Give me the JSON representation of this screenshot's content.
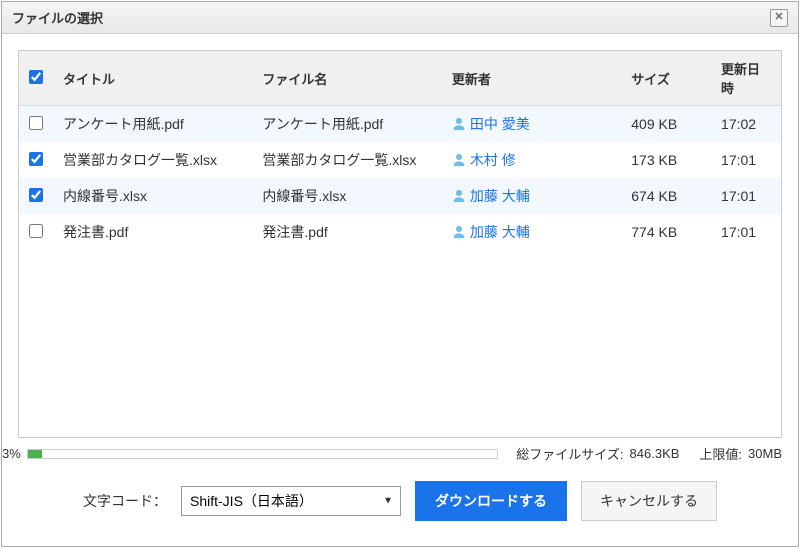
{
  "titlebar": {
    "title": "ファイルの選択"
  },
  "table": {
    "headers": {
      "title": "タイトル",
      "filename": "ファイル名",
      "user": "更新者",
      "size": "サイズ",
      "date": "更新日時"
    },
    "rows": [
      {
        "checked": false,
        "title": "アンケート用紙.pdf",
        "filename": "アンケート用紙.pdf",
        "user": "田中 愛美",
        "size": "409 KB",
        "date": "17:02"
      },
      {
        "checked": true,
        "title": "営業部カタログ一覧.xlsx",
        "filename": "営業部カタログ一覧.xlsx",
        "user": "木村 修",
        "size": "173 KB",
        "date": "17:01"
      },
      {
        "checked": true,
        "title": "内線番号.xlsx",
        "filename": "内線番号.xlsx",
        "user": "加藤 大輔",
        "size": "674 KB",
        "date": "17:01"
      },
      {
        "checked": false,
        "title": "発注書.pdf",
        "filename": "発注書.pdf",
        "user": "加藤 大輔",
        "size": "774 KB",
        "date": "17:01"
      }
    ]
  },
  "status": {
    "percent": "3%",
    "total_label": "総ファイルサイズ:",
    "total_value": "846.3KB",
    "limit_label": "上限値:",
    "limit_value": "30MB"
  },
  "footer": {
    "encoding_label": "文字コード：",
    "encoding_value": "Shift-JIS（日本語）",
    "download_label": "ダウンロードする",
    "cancel_label": "キャンセルする"
  }
}
